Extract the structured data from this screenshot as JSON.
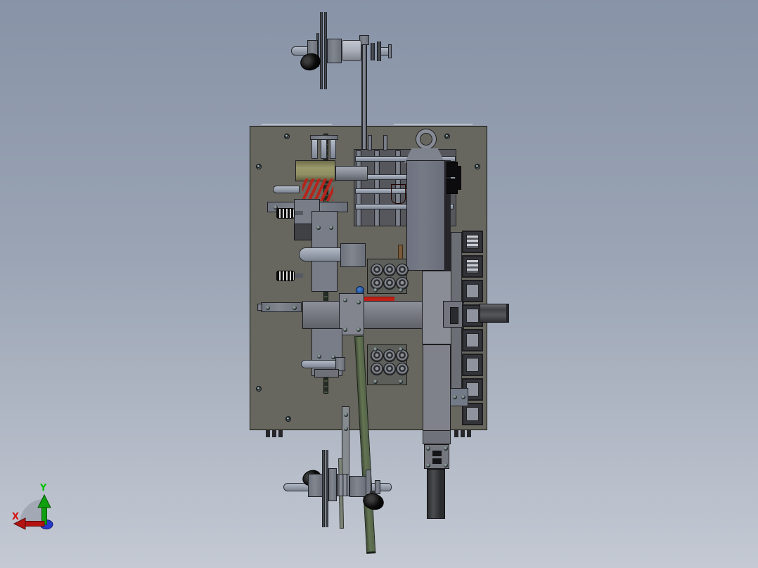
{
  "triad": {
    "x_label": "X",
    "y_label": "Y"
  },
  "colors": {
    "bg_top": "#8893a7",
    "bg_bottom": "#c4c9d3",
    "plate": "#67665f",
    "plate_edge": "#17170f",
    "metal_light": "#9aa2b0",
    "metal_mid": "#81868f",
    "metal_dark": "#3f4145",
    "steel_panel": "#767a85",
    "yellow_part": "#9a996c",
    "spring_red": "#b5251c",
    "roller_red": "#8f4a42",
    "belt_green": "#647552",
    "pointer_red": "#c01f16",
    "knob_blue": "#2a5fa8",
    "bronze": "#7a5a3a",
    "axis_x_red": "#cc1111",
    "axis_y_green": "#00b400",
    "axis_z_blue": "#2838c8"
  }
}
